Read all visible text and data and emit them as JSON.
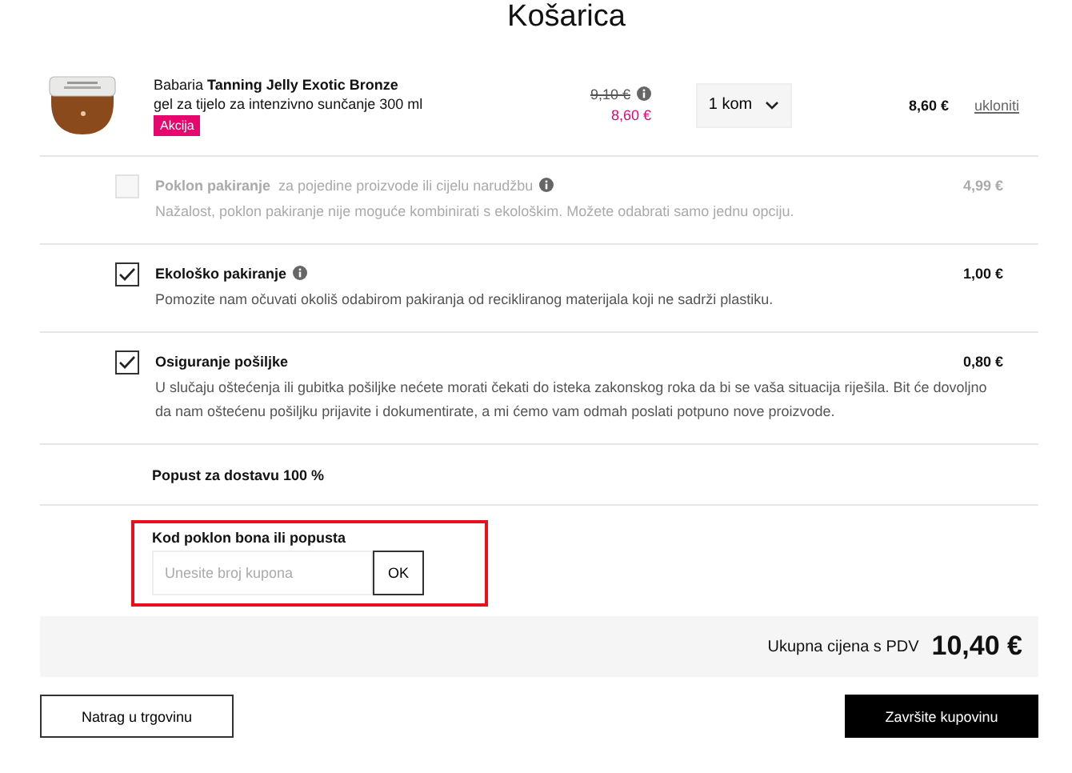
{
  "title": "Košarica",
  "product": {
    "name": "Babaria **Tanning Jelly Exotic Bronze**",
    "description": "gel za tijelo za intenzivno sunčanje 300 ml",
    "badge": "Akcija",
    "old_price": "9,10 €",
    "price": "8,60 €",
    "quantity": "1 kom",
    "total": "8,60 €",
    "remove": "ukloniti"
  },
  "options": [
    {
      "title": "Poklon pakiranje",
      "subtitle": "za pojedine proizvode ili cijelu narudžbu",
      "kind": "info",
      "text": "Nažalost, poklon pakiranje nije moguće kombinirati s ekološkim. Možete odabrati samo jednu opciju.",
      "price": "4,99 €",
      "checked": false,
      "disabled": true
    },
    {
      "title": "Ekološko pakiranje",
      "kind": "info",
      "text": "Pomozite nam očuvati okoliš odabirom pakiranja od recikliranog materijala koji ne sadrži plastiku.",
      "price": "1,00 €",
      "checked": true,
      "disabled": false
    },
    {
      "title": "Osiguranje pošiljke",
      "kind": "plain",
      "text": "U slučaju oštećenja ili gubitka pošiljke nećete morati čekati do isteka zakonskog roka da bi se vaša situacija riješila. Bit će dovoljno da nam oštećenu pošiljku prijavite i dokumentirate, a mi ćemo vam odmah poslati potpuno nove proizvode.",
      "price": "0,80 €",
      "checked": true,
      "disabled": false
    }
  ],
  "shipping_discount": "Popust za dostavu 100 %",
  "coupon": {
    "label": "Kod poklon bona ili popusta",
    "placeholder": "Unesite broj kupona",
    "button": "OK"
  },
  "total": {
    "label": "Ukupna cijena s PDV",
    "value": "10,40 €"
  },
  "buttons": {
    "back": "Natrag u trgovinu",
    "checkout": "Završite kupovinu"
  }
}
